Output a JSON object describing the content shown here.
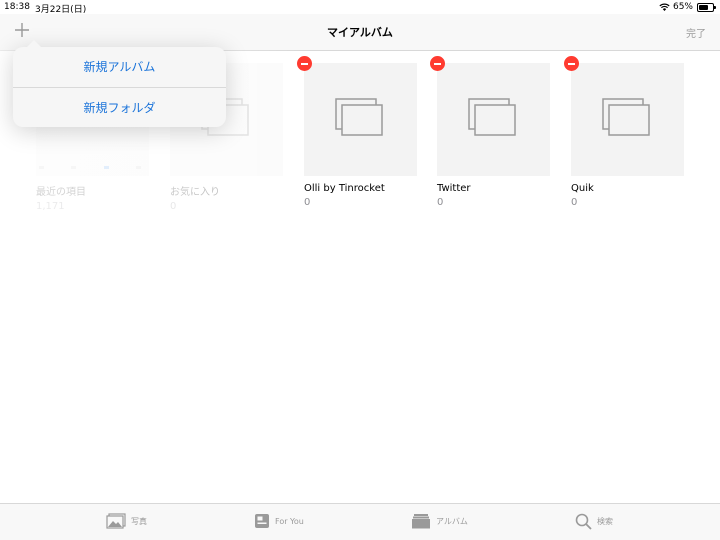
{
  "status_bar": {
    "time": "18:38",
    "date": "3月22日(日)",
    "battery_percent": "65%",
    "battery_level": 0.65
  },
  "nav": {
    "title": "マイアルバム",
    "done_label": "完了",
    "add_icon": "plus-icon"
  },
  "popover": {
    "items": [
      {
        "label": "新規アルバム"
      },
      {
        "label": "新規フォルダ"
      }
    ]
  },
  "albums": [
    {
      "name": "最近の項目",
      "count": "1,171"
    },
    {
      "name": "お気に入り",
      "count": "0"
    },
    {
      "name": "Olli by Tinrocket",
      "count": "0"
    },
    {
      "name": "Twitter",
      "count": "0"
    },
    {
      "name": "Quik",
      "count": "0"
    }
  ],
  "tabs": [
    {
      "label": "写真",
      "icon": "photos-icon"
    },
    {
      "label": "For You",
      "icon": "for-you-icon"
    },
    {
      "label": "アルバム",
      "icon": "albums-icon"
    },
    {
      "label": "検索",
      "icon": "search-icon"
    }
  ],
  "colors": {
    "delete": "#ff3b30",
    "accent": "#1a73d9",
    "thumb_bg": "#f3f3f3"
  }
}
